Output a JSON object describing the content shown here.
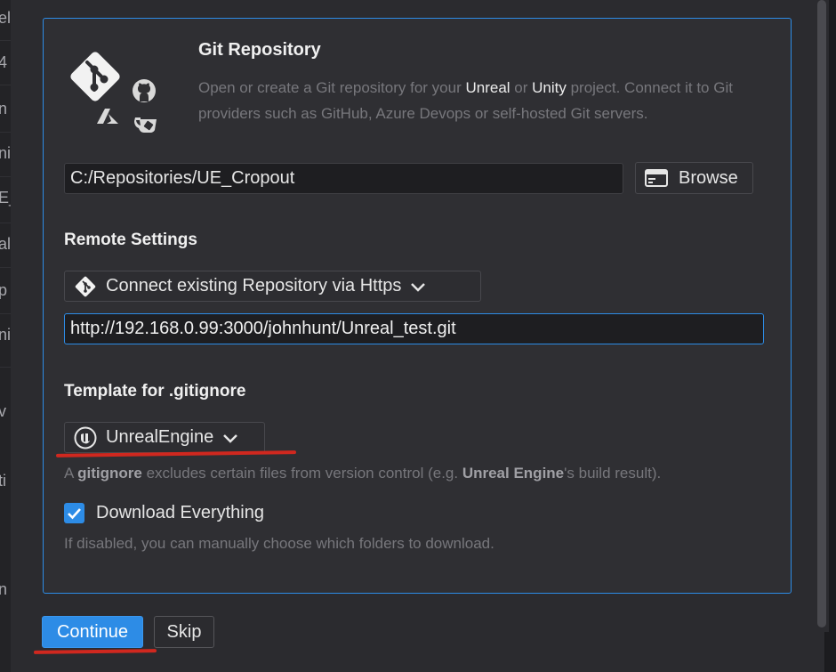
{
  "background_list": {
    "chars": [
      "el",
      "4",
      "n",
      "ni",
      "E_",
      "ali",
      "p",
      "ni",
      "v",
      "ti",
      "n"
    ]
  },
  "card": {
    "title": "Git Repository",
    "description": {
      "part1": "Open or create a Git repository for your ",
      "unreal": "Unreal",
      "or": " or ",
      "unity": "Unity",
      "part2": " project. Connect it to Git providers such as GitHub, Azure Devops or self-hosted Git servers."
    },
    "icons": [
      "git-logo-icon",
      "github-icon",
      "azure-devops-icon",
      "gitea-icon"
    ],
    "path_value": "C:/Repositories/UE_Cropout",
    "browse_label": "Browse",
    "remote_heading": "Remote Settings",
    "remote_mode": "Connect existing Repository via Https",
    "remote_url": "http://192.168.0.99:3000/johnhunt/Unreal_test.git",
    "template_heading": "Template for .gitignore",
    "template_value": "UnrealEngine",
    "gitignore_hint": {
      "a": "A ",
      "gitignore": "gitignore",
      "middle": " excludes certain files from version control (e.g. ",
      "unreal_engine": "Unreal Engine",
      "end": "'s build result)."
    },
    "download_label": "Download Everything",
    "download_checked": true,
    "download_hint": "If disabled, you can manually choose which folders to download."
  },
  "footer": {
    "continue_label": "Continue",
    "skip_label": "Skip"
  },
  "colors": {
    "accent": "#2d8ce6",
    "annotation": "#d0281f",
    "card_bg": "#2f2f33"
  }
}
